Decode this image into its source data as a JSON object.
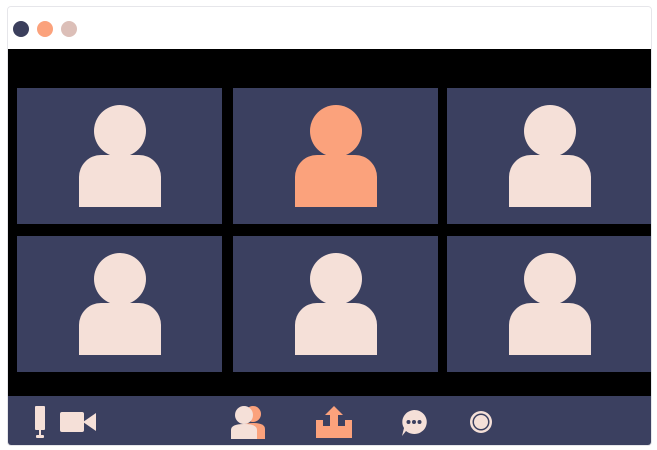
{
  "window": {
    "controls": [
      {
        "name": "window-dot-close",
        "color": "#3b3f5c"
      },
      {
        "name": "window-dot-minimize",
        "color": "#fba27c"
      },
      {
        "name": "window-dot-maximize",
        "color": "#dcbfb8"
      }
    ]
  },
  "colors": {
    "stage": "#000000",
    "tile": "#3b4060",
    "avatar": "#f5e0d8",
    "active_speaker": "#fba27c",
    "toolbar": "#3b4060",
    "icon_light": "#f5e0d8",
    "icon_accent": "#fba27c"
  },
  "participants": [
    {
      "position": 1,
      "speaking": false
    },
    {
      "position": 2,
      "speaking": true
    },
    {
      "position": 3,
      "speaking": false
    },
    {
      "position": 4,
      "speaking": false
    },
    {
      "position": 5,
      "speaking": false
    },
    {
      "position": 6,
      "speaking": false
    }
  ],
  "toolbar": {
    "buttons": [
      {
        "name": "mute-button",
        "icon": "microphone-icon"
      },
      {
        "name": "video-button",
        "icon": "video-camera-icon"
      },
      {
        "name": "participants-button",
        "icon": "participants-icon"
      },
      {
        "name": "share-screen-button",
        "icon": "share-screen-icon"
      },
      {
        "name": "chat-button",
        "icon": "chat-bubble-icon"
      },
      {
        "name": "record-button",
        "icon": "record-icon"
      }
    ]
  }
}
